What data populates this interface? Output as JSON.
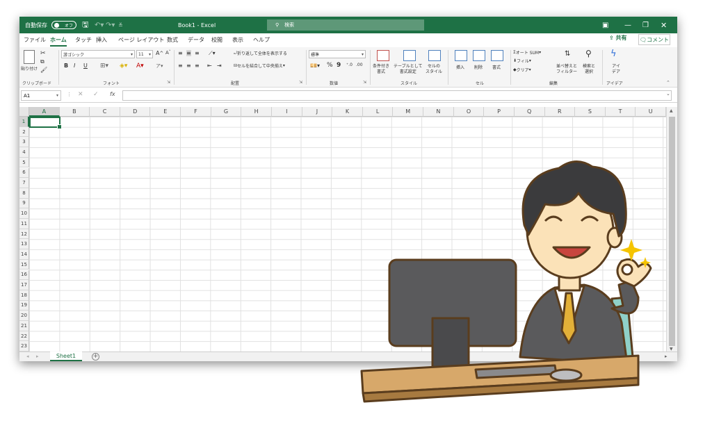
{
  "titlebar": {
    "autosave_label": "自動保存",
    "autosave_state": "オフ",
    "doc_title": "Book1 - Excel",
    "search_placeholder": "検索",
    "undo_icon": "undo-icon",
    "redo_icon": "redo-icon"
  },
  "tabs": [
    "ファイル",
    "ホーム",
    "タッチ",
    "挿入",
    "ページ レイアウト",
    "数式",
    "データ",
    "校閲",
    "表示",
    "ヘルプ"
  ],
  "active_tab": "ホーム",
  "share_label": "共有",
  "comment_label": "コメント",
  "ribbon": {
    "clipboard": {
      "paste": "貼り付け",
      "group": "クリップボード"
    },
    "font": {
      "name": "游ゴシック",
      "size": "11",
      "bold": "B",
      "italic": "I",
      "underline": "U",
      "group": "フォント"
    },
    "alignment": {
      "wrap": "折り返して全体を表示する",
      "merge": "セルを結合して中央揃え",
      "group": "配置"
    },
    "number": {
      "format": "標準",
      "percent": "%",
      "comma": "9",
      "group": "数値"
    },
    "styles": {
      "conditional": [
        "条件付き",
        "書式"
      ],
      "table": [
        "テーブルとして",
        "書式設定"
      ],
      "cell": [
        "セルの",
        "スタイル"
      ],
      "group": "スタイル"
    },
    "cells": {
      "insert": "挿入",
      "delete": "削除",
      "format": "書式",
      "group": "セル"
    },
    "editing": {
      "autosum": "オート SUM",
      "fill": "フィル",
      "clear": "クリア",
      "sort": [
        "並べ替えと",
        "フィルター"
      ],
      "find": [
        "検索と",
        "選択"
      ],
      "group": "編集"
    },
    "ideas": {
      "label": [
        "アイ",
        "デア"
      ],
      "group": "アイデア"
    }
  },
  "formula_bar": {
    "name_box": "A1",
    "fx": "fx",
    "value": ""
  },
  "columns": [
    "A",
    "B",
    "C",
    "D",
    "E",
    "F",
    "G",
    "H",
    "I",
    "J",
    "K",
    "L",
    "M",
    "N",
    "O",
    "P",
    "Q",
    "R",
    "S",
    "T",
    "U"
  ],
  "rows": [
    "1",
    "2",
    "3",
    "4",
    "5",
    "6",
    "7",
    "8",
    "9",
    "10",
    "11",
    "12",
    "13",
    "14",
    "15",
    "16",
    "17",
    "18",
    "19",
    "20",
    "21",
    "22",
    "23"
  ],
  "selected_cell": "A1",
  "sheet_tab": "Sheet1",
  "colors": {
    "brand": "#1e7145",
    "ribbon_bg": "#f5f5f5",
    "grid_line": "#e1e1e1"
  }
}
